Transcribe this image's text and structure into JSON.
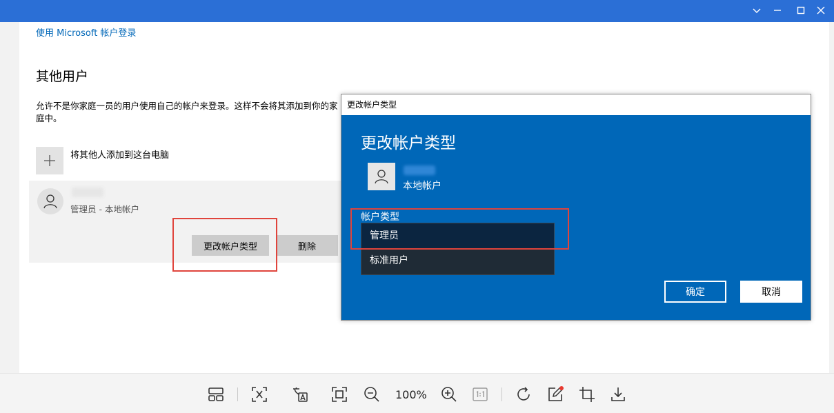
{
  "viewer": {
    "toolbar_icons": [
      "layout-icon",
      "text-extract-icon",
      "translate-icon",
      "fit-screen-icon",
      "zoom-out-icon",
      "zoom-in-icon",
      "actual-size-icon",
      "rotate-icon",
      "edit-icon",
      "crop-icon",
      "download-icon"
    ],
    "zoom_level": "100%",
    "title_controls": [
      "chevron-down-icon",
      "minimize-icon",
      "maximize-icon",
      "close-icon"
    ]
  },
  "settings": {
    "ms_signin_link": "使用 Microsoft 帐户登录",
    "other_users_heading": "其他用户",
    "description": "允许不是你家庭一员的用户使用自己的帐户来登录。这样不会将其添加到你的家庭中。",
    "add_user_label": "将其他人添加到这台电脑",
    "user_role": "管理员 - 本地帐户",
    "change_type_button": "更改帐户类型",
    "delete_button": "删除"
  },
  "dialog": {
    "window_title": "更改帐户类型",
    "heading": "更改帐户类型",
    "account_kind": "本地帐户",
    "type_label": "帐户类型",
    "options": [
      "管理员",
      "标准用户"
    ],
    "selected_option": "管理员",
    "ok_button": "确定",
    "cancel_button": "取消"
  },
  "colors": {
    "accent_blue": "#0067b8",
    "highlight_red": "#e0443c",
    "titlebar_blue": "#2b6fd6"
  }
}
